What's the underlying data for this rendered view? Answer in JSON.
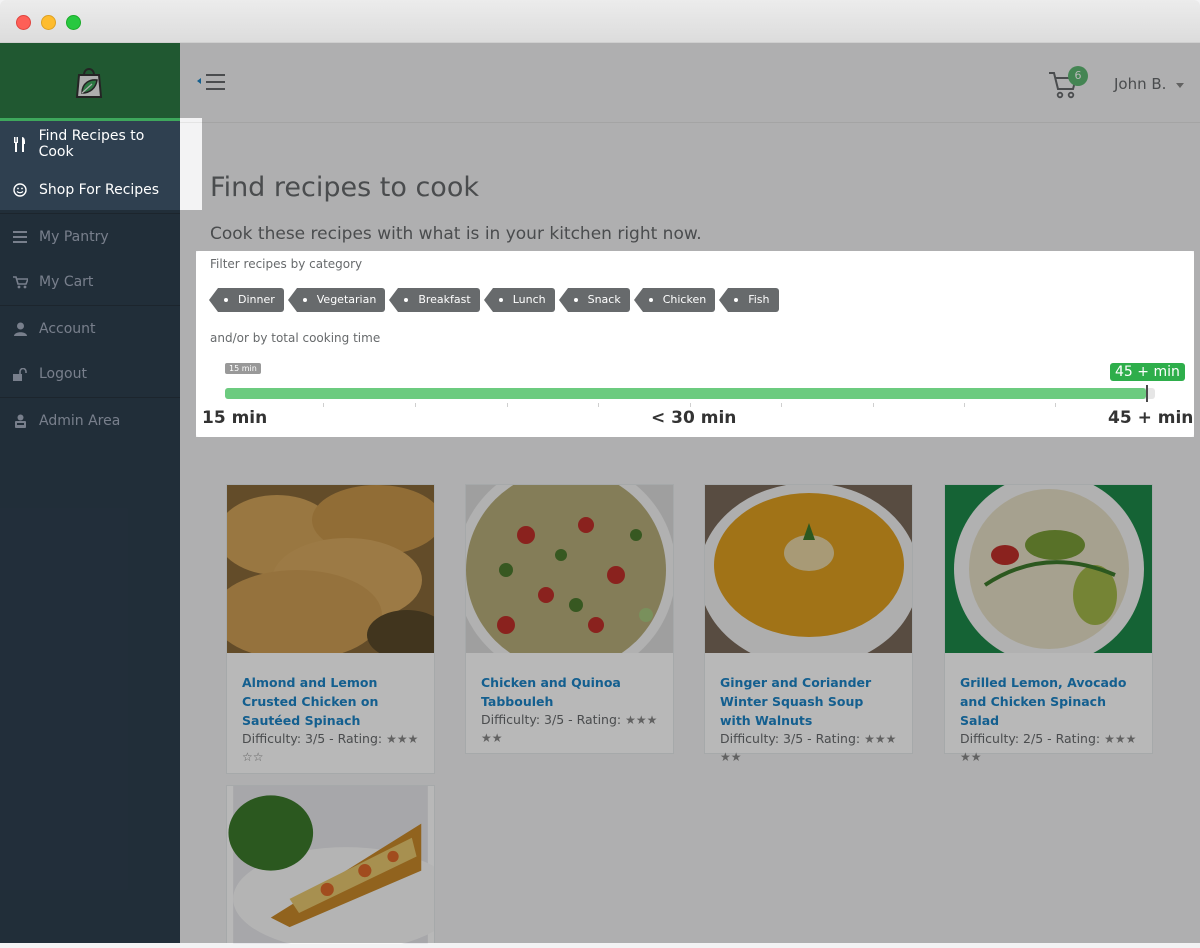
{
  "sidebar": {
    "items": [
      {
        "label": "Find Recipes to Cook",
        "icon": "cutlery-icon"
      },
      {
        "label": "Shop For Recipes",
        "icon": "smile-icon"
      },
      {
        "label": "My Pantry",
        "icon": "list-icon"
      },
      {
        "label": "My Cart",
        "icon": "cart-icon"
      },
      {
        "label": "Account",
        "icon": "user-icon"
      },
      {
        "label": "Logout",
        "icon": "unlock-icon"
      },
      {
        "label": "Admin Area",
        "icon": "admin-icon"
      }
    ]
  },
  "topbar": {
    "cart_count": "6",
    "user_name": "John B."
  },
  "main": {
    "title": "Find recipes to cook",
    "subtitle": "Cook these recipes with what is in your kitchen right now."
  },
  "filter": {
    "category_label": "Filter recipes by category",
    "categories": [
      "Dinner",
      "Vegetarian",
      "Breakfast",
      "Lunch",
      "Snack",
      "Chicken",
      "Fish"
    ],
    "time_label": "and/or by total cooking time",
    "slider": {
      "from_badge": "15 min",
      "to_badge": "45 + min",
      "value_fraction": 0.99,
      "grid_labels": [
        "15 min",
        "< 30 min",
        "45 + min"
      ]
    }
  },
  "recipes": [
    {
      "title": "Almond and Lemon Crusted Chicken on Sautéed Spinach",
      "meta": "Difficulty: 3/5 - Rating:",
      "rating": 3
    },
    {
      "title": "Chicken and Quinoa Tabbouleh",
      "meta": "Difficulty: 3/5 - Rating:",
      "rating": 5
    },
    {
      "title": "Ginger and Coriander Winter Squash Soup with Walnuts",
      "meta": "Difficulty: 3/5 - Rating:",
      "rating": 5
    },
    {
      "title": "Grilled Lemon, Avocado and Chicken Spinach Salad",
      "meta": "Difficulty: 2/5 - Rating:",
      "rating": 5
    }
  ],
  "colors": {
    "sidebar_bg": "#2f4050",
    "brand_green": "#2d7a45",
    "accent_green": "#2eae4b",
    "link_blue": "#1c84c6"
  }
}
